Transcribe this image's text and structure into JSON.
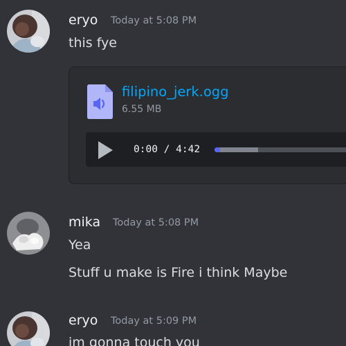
{
  "messages": [
    {
      "author": "eryo",
      "timestamp": "Today at 5:08 PM",
      "text": "this fye",
      "attachment": {
        "filename": "filipino_jerk.ogg",
        "size": "6.55 MB",
        "icon": "audio-file-icon",
        "player": {
          "current_time": "0:00",
          "separator": "/",
          "duration": "4:42",
          "played_fraction": 0.0,
          "buffered_fraction": 0.3
        }
      }
    },
    {
      "author": "mika",
      "timestamp": "Today at 5:08 PM",
      "lines": [
        "Yea",
        "Stuff u make is Fire i think Maybe"
      ]
    },
    {
      "author": "eryo",
      "timestamp": "Today at 5:09 PM",
      "text": "im gonna touch you"
    }
  ],
  "colors": {
    "background": "#313338",
    "link": "#00a8fc",
    "accent": "#5865f2",
    "file_icon": "#b0b6f7"
  }
}
